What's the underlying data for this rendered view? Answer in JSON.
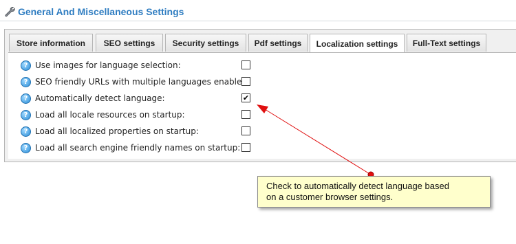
{
  "header": {
    "title": "General And Miscellaneous Settings",
    "icon": "wrench-icon"
  },
  "tabs": [
    {
      "label": "Store information",
      "active": false
    },
    {
      "label": "SEO settings",
      "active": false
    },
    {
      "label": "Security settings",
      "active": false
    },
    {
      "label": "Pdf settings",
      "active": false
    },
    {
      "label": "Localization settings",
      "active": true
    },
    {
      "label": "Full-Text settings",
      "active": false
    }
  ],
  "settings": [
    {
      "label": "Use images for language selection:",
      "checked": false
    },
    {
      "label": "SEO friendly URLs with multiple languages enabled:",
      "checked": false
    },
    {
      "label": "Automatically detect language:",
      "checked": true
    },
    {
      "label": "Load all locale resources on startup:",
      "checked": false
    },
    {
      "label": "Load all localized properties on startup:",
      "checked": false
    },
    {
      "label": "Load all search engine friendly names on startup:",
      "checked": false
    }
  ],
  "callout": {
    "line1": "Check to automatically detect language based",
    "line2": "on a customer browser settings."
  },
  "colors": {
    "title": "#2f7dc1",
    "arrow": "#e01010",
    "callout_bg": "#ffffcc"
  }
}
